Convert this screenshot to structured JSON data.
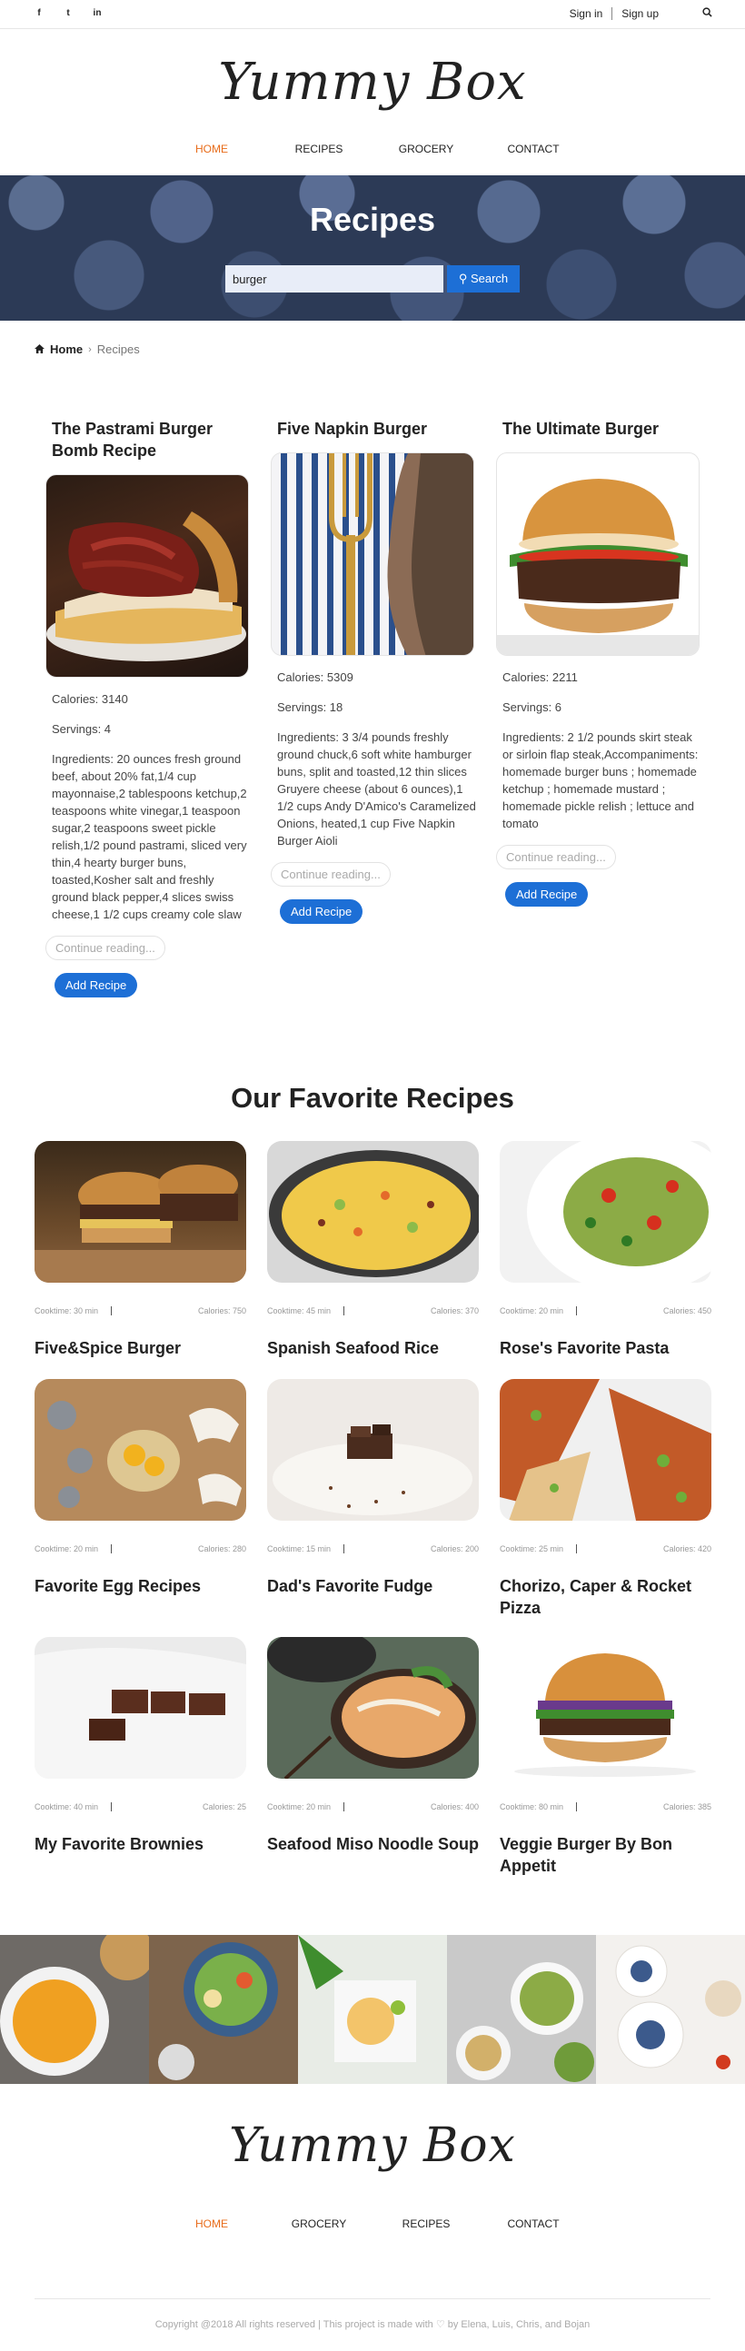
{
  "topbar": {
    "social": [
      "f",
      "t",
      "in"
    ],
    "sign_in": "Sign in",
    "sign_up": "Sign up",
    "search_icon": "search-icon"
  },
  "brand": {
    "logo": "Yummy Box"
  },
  "nav": {
    "home": "HOME",
    "recipes": "RECIPES",
    "grocery": "GROCERY",
    "contact": "CONTACT"
  },
  "hero": {
    "title": "Recipes",
    "search_value": "burger",
    "search_button": "Search"
  },
  "breadcrumb": {
    "home": "Home",
    "current": "Recipes"
  },
  "results": [
    {
      "title": "The Pastrami Burger Bomb Recipe",
      "calories": "Calories: 3140",
      "servings": "Servings: 4",
      "ingredients": "Ingredients: 20 ounces fresh ground beef, about 20% fat,1/4 cup mayonnaise,2 tablespoons ketchup,2 teaspoons white vinegar,1 teaspoon sugar,2 teaspoons sweet pickle relish,1/2 pound pastrami, sliced very thin,4 hearty burger buns, toasted,Kosher salt and freshly ground black pepper,4 slices swiss cheese,1 1/2 cups creamy cole slaw",
      "continue": "Continue reading...",
      "add": "Add Recipe"
    },
    {
      "title": "Five Napkin Burger",
      "calories": "Calories: 5309",
      "servings": "Servings: 18",
      "ingredients": "Ingredients: 3 3/4 pounds freshly ground chuck,6 soft white hamburger buns, split and toasted,12 thin slices Gruyere cheese (about 6 ounces),1 1/2 cups Andy D'Amico's Caramelized Onions, heated,1 cup Five Napkin Burger Aioli",
      "continue": "Continue reading...",
      "add": "Add Recipe"
    },
    {
      "title": "The Ultimate Burger",
      "calories": "Calories: 2211",
      "servings": "Servings: 6",
      "ingredients": "Ingredients: 2 1/2 pounds skirt steak or sirloin flap steak,Accompaniments: homemade burger buns ; homemade ketchup ; homemade mustard ; homemade pickle relish ; lettuce and tomato",
      "continue": "Continue reading...",
      "add": "Add Recipe"
    }
  ],
  "favorites": {
    "title": "Our Favorite Recipes",
    "items": [
      {
        "name": "Five&Spice Burger",
        "cooktime": "Cooktime: 30 min",
        "calories": "Calories: 750"
      },
      {
        "name": "Spanish Seafood Rice",
        "cooktime": "Cooktime: 45 min",
        "calories": "Calories: 370"
      },
      {
        "name": "Rose's Favorite Pasta",
        "cooktime": "Cooktime: 20 min",
        "calories": "Calories: 450"
      },
      {
        "name": "Favorite Egg Recipes",
        "cooktime": "Cooktime: 20 min",
        "calories": "Calories: 280"
      },
      {
        "name": "Dad's Favorite Fudge",
        "cooktime": "Cooktime: 15 min",
        "calories": "Calories: 200"
      },
      {
        "name": "Chorizo, Caper & Rocket Pizza",
        "cooktime": "Cooktime: 25 min",
        "calories": "Calories: 420"
      },
      {
        "name": "My Favorite Brownies",
        "cooktime": "Cooktime: 40 min",
        "calories": "Calories: 25"
      },
      {
        "name": "Seafood Miso Noodle Soup",
        "cooktime": "Cooktime: 20 min",
        "calories": "Calories: 400"
      },
      {
        "name": "Veggie Burger By Bon Appetit",
        "cooktime": "Cooktime: 80 min",
        "calories": "Calories: 385"
      }
    ]
  },
  "footer": {
    "copyright": "Copyright @2018 All rights reserved | This project is made with ♡ by Elena, Luis, Chris, and Bojan"
  },
  "colors": {
    "accent": "#e86c1a",
    "primary": "#1d6fd6"
  }
}
